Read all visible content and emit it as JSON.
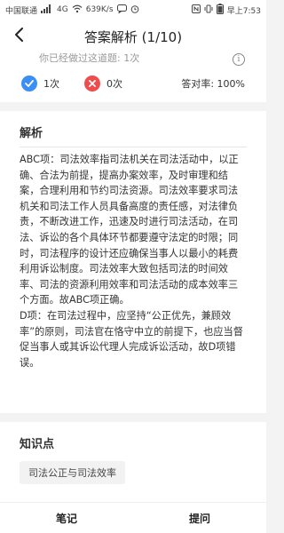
{
  "status_bar": {
    "carrier": "中国联通",
    "net_type": "4G",
    "speed": "639K/s",
    "time": "早上7:53"
  },
  "header": {
    "title": "答案解析 (1/10)"
  },
  "stats": {
    "partial_text": "你已经做过这道题: 1次",
    "correct_count": "1次",
    "wrong_count": "0次",
    "accuracy": "答对率: 100%"
  },
  "analysis": {
    "title": "解析",
    "body": "ABC项：司法效率指司法机关在司法活动中，以正确、合法为前提，提高办案效率，及时审理和结案，合理利用和节约司法资源。司法效率要求司法机关和司法工作人员具备高度的责任感，对法律负责，不断改进工作，迅速及时进行司法活动，在司法、诉讼的各个具体环节都要遵守法定的时限；同时，司法程序的设计还应确保当事人以最小的耗费利用诉讼制度。司法效率大致包括司法的时间效率、司法的资源利用效率和司法活动的成本效率三个方面。故ABC项正确。\nD项：在司法过程中，应坚持“公正优先，兼顾效率”的原则，司法官在恪守中立的前提下，也应当督促当事人或其诉讼代理人完成诉讼活动，故D项错误。"
  },
  "knowledge": {
    "title": "知识点",
    "tag": "司法公正与司法效率"
  },
  "bottom_bar": {
    "notes_label": "笔记",
    "ask_label": "提问"
  },
  "colors": {
    "correct": "#3a8ef6",
    "wrong": "#ef4d4d"
  }
}
